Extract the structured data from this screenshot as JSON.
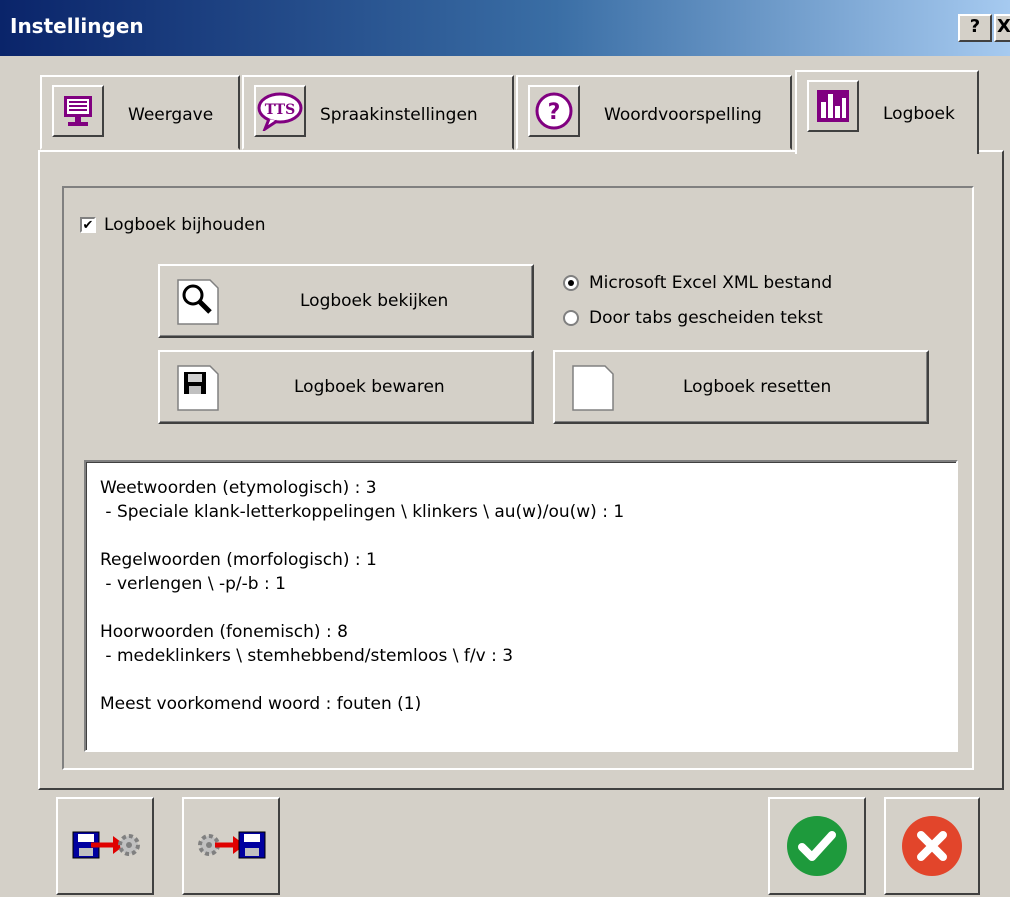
{
  "window": {
    "title": "Instellingen",
    "help_label": "?",
    "close_label": "X"
  },
  "tabs": [
    {
      "label": "Weergave",
      "icon": "monitor-icon"
    },
    {
      "label": "Spraakinstellingen",
      "icon": "tts-icon"
    },
    {
      "label": "Woordvoorspelling",
      "icon": "question-icon"
    },
    {
      "label": "Logboek",
      "icon": "chart-icon",
      "active": true
    }
  ],
  "logboek": {
    "keep_log_label": "Logboek bijhouden",
    "keep_log_checked": true,
    "view_button_label": "Logboek bekijken",
    "save_button_label": "Logboek bewaren",
    "reset_button_label": "Logboek resetten",
    "format_options": [
      {
        "label": "Microsoft Excel XML bestand",
        "selected": true
      },
      {
        "label": "Door tabs gescheiden tekst",
        "selected": false
      }
    ],
    "log_lines": [
      "Weetwoorden (etymologisch) : 3",
      " - Speciale klank-letterkoppelingen \\ klinkers \\ au(w)/ou(w) : 1",
      "",
      "Regelwoorden (morfologisch) : 1",
      " - verlengen \\ -p/-b : 1",
      "",
      "Hoorwoorden (fonemisch) : 8",
      " - medeklinkers \\ stemhebbend/stemloos \\ f/v : 3",
      "",
      "Meest voorkomend woord : fouten (1)"
    ]
  },
  "footer": {
    "export_icon": "save-to-settings-icon",
    "import_icon": "settings-to-save-icon",
    "ok_icon": "checkmark-icon",
    "cancel_icon": "cancel-x-icon"
  },
  "colors": {
    "tab_icon_purple": "#800080",
    "ok_green": "#1e9a3c",
    "cancel_red": "#e2452b"
  }
}
